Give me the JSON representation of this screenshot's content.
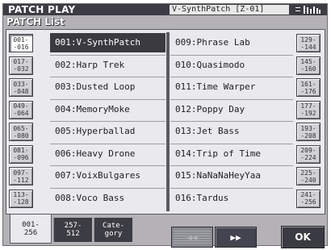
{
  "header": {
    "title": "PATCH PLAY",
    "current_patch": "V-SynthPatch [Z-01]",
    "status_icon": "="
  },
  "list_title": "PATCH List",
  "left_ranges": [
    {
      "label": "001-\n-016",
      "selected": true
    },
    {
      "label": "017-\n-032",
      "selected": false
    },
    {
      "label": "033-\n-048",
      "selected": false
    },
    {
      "label": "049-\n-064",
      "selected": false
    },
    {
      "label": "065-\n-080",
      "selected": false
    },
    {
      "label": "081-\n-096",
      "selected": false
    },
    {
      "label": "097-\n-112",
      "selected": false
    },
    {
      "label": "113-\n-128",
      "selected": false
    }
  ],
  "right_ranges": [
    {
      "label": "129-\n-144"
    },
    {
      "label": "145-\n-160"
    },
    {
      "label": "161-\n-176"
    },
    {
      "label": "177-\n-192"
    },
    {
      "label": "193-\n-208"
    },
    {
      "label": "209-\n-224"
    },
    {
      "label": "225-\n-240"
    },
    {
      "label": "241-\n-256"
    }
  ],
  "patches_left": [
    {
      "name": "001:V-SynthPatch",
      "selected": true
    },
    {
      "name": "002:Harp Trek",
      "selected": false
    },
    {
      "name": "003:Dusted Loop",
      "selected": false
    },
    {
      "name": "004:MemoryMoke",
      "selected": false
    },
    {
      "name": "005:Hyperballad",
      "selected": false
    },
    {
      "name": "006:Heavy Drone",
      "selected": false
    },
    {
      "name": "007:VoixBulgares",
      "selected": false
    },
    {
      "name": "008:Voco Bass",
      "selected": false
    }
  ],
  "patches_right": [
    {
      "name": "009:Phrase Lab"
    },
    {
      "name": "010:Quasimodo"
    },
    {
      "name": "011:Time Warper"
    },
    {
      "name": "012:Poppy Day"
    },
    {
      "name": "013:Jet Bass"
    },
    {
      "name": "014:Trip of Time"
    },
    {
      "name": "015:NaNaNaHeyYaa"
    },
    {
      "name": "016:Tardus"
    }
  ],
  "bottom_tabs": [
    {
      "label": "001-\n256",
      "active": true
    },
    {
      "label": "257-\n512",
      "active": false
    },
    {
      "label": "Cate-\ngory",
      "active": false
    }
  ],
  "nav": {
    "prev_label": "◀◀",
    "next_label": "▶▶",
    "ok_label": "OK"
  }
}
